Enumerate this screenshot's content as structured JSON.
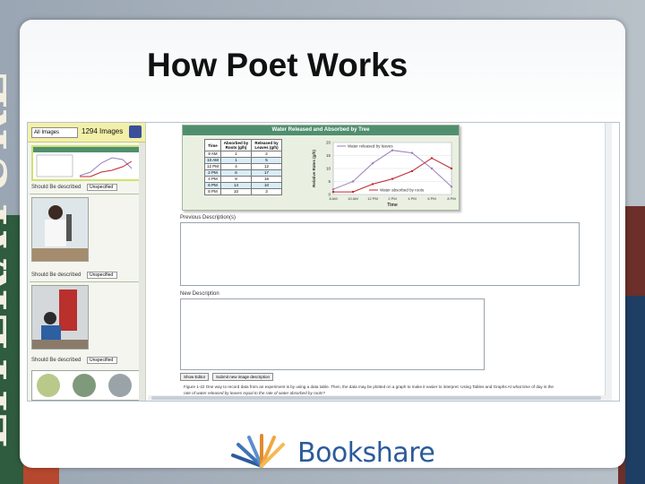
{
  "slide": {
    "title": "How Poet Works"
  },
  "left_pane": {
    "filter_value": "All Images",
    "image_count": "1294 Images",
    "items": [
      {
        "label": "Should Be described",
        "status": "Unspecified"
      },
      {
        "label": "Should Be described",
        "status": "Unspecified"
      },
      {
        "label": "Should Be described",
        "status": "Unspecified"
      }
    ]
  },
  "figure": {
    "heading": "Water Released and Absorbed by Tree",
    "table_headers": [
      "Time",
      "Absorbed by Roots (g/h)",
      "Released by Leaves (g/h)"
    ],
    "rows": [
      [
        "8 AM",
        "1",
        "2"
      ],
      [
        "10 AM",
        "1",
        "5"
      ],
      [
        "12 PM",
        "4",
        "12"
      ],
      [
        "2 PM",
        "6",
        "17"
      ],
      [
        "4 PM",
        "9",
        "16"
      ],
      [
        "6 PM",
        "14",
        "10"
      ],
      [
        "8 PM",
        "10",
        "3"
      ]
    ],
    "legend_leaves": "Water released by leaves",
    "legend_roots": "Water absorbed by roots",
    "ylabel": "Relative Rates (g/h)",
    "xlabel": "Time",
    "y_ticks": [
      "20",
      "15",
      "10",
      "5",
      "0"
    ],
    "x_ticks": [
      "8 AM",
      "10 AM",
      "12 PM",
      "2 PM",
      "4 PM",
      "6 PM",
      "8 PM"
    ],
    "colors": {
      "leaves": "#9b7fb8",
      "roots": "#c0262d",
      "header": "#4f8f6f"
    }
  },
  "chart_data": {
    "type": "line",
    "title": "Water Released and Absorbed by Tree",
    "x": [
      "8 AM",
      "10 AM",
      "12 PM",
      "2 PM",
      "4 PM",
      "6 PM",
      "8 PM"
    ],
    "series": [
      {
        "name": "Water released by leaves",
        "values": [
          2,
          5,
          12,
          17,
          16,
          10,
          3
        ]
      },
      {
        "name": "Water absorbed by roots",
        "values": [
          1,
          1,
          4,
          6,
          9,
          14,
          10
        ]
      }
    ],
    "xlabel": "Time",
    "ylabel": "Relative Rates (g/h)",
    "ylim": [
      0,
      20
    ]
  },
  "form": {
    "previous_label": "Previous Description(s)",
    "new_label": "New Description",
    "show_editor": "Show Editor",
    "submit": "Submit new image description"
  },
  "caption": {
    "line1": "Figure 1-22 One way to record data from an experiment is by using a data table. Then, the data may be plotted on a graph to make it easier to interpret. Using Tables and Graphs At what time of day is the",
    "line2": "rate of water released by leaves equal to the rate of water absorbed by roots?"
  },
  "logo": {
    "text": "Bookshare",
    "color": "#2b5b9c"
  }
}
